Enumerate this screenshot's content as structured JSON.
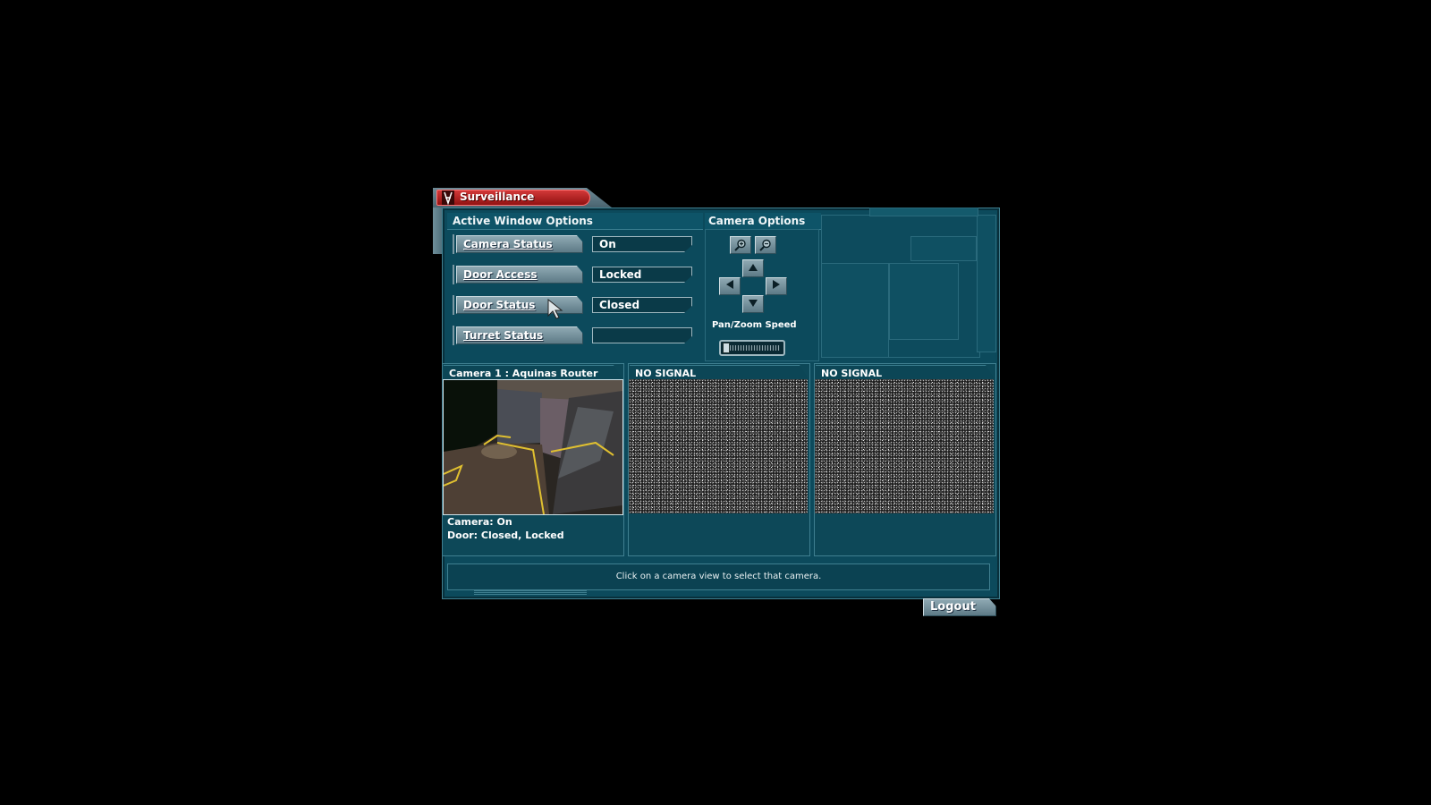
{
  "window": {
    "title": "Surveillance"
  },
  "active_window_options": {
    "heading": "Active Window Options",
    "rows": [
      {
        "label": "Camera Status",
        "value": "On"
      },
      {
        "label": "Door Access",
        "value": "Locked"
      },
      {
        "label": "Door Status",
        "value": "Closed"
      },
      {
        "label": "Turret Status",
        "value": ""
      }
    ]
  },
  "camera_options": {
    "heading": "Camera Options",
    "speed_label": "Pan/Zoom Speed",
    "speed_level": 0.0
  },
  "cameras": [
    {
      "title": "Camera 1 : Aquinas Router",
      "status_lines": [
        "Camera: On",
        "Door: Closed, Locked"
      ]
    },
    {
      "title": "NO SIGNAL",
      "status_lines": []
    },
    {
      "title": "NO SIGNAL",
      "status_lines": []
    }
  ],
  "status_bar": {
    "message": "Click on a camera view to select that camera."
  },
  "logout": {
    "label": "Logout"
  },
  "colors": {
    "panel": "#0c4a5c",
    "title_tab": "#b82020",
    "button": "#7a96a1"
  },
  "icons": {
    "zoom_in": "zoom-in-icon",
    "zoom_out": "zoom-out-icon",
    "up": "arrow-up-icon",
    "down": "arrow-down-icon",
    "left": "arrow-left-icon",
    "right": "arrow-right-icon"
  }
}
